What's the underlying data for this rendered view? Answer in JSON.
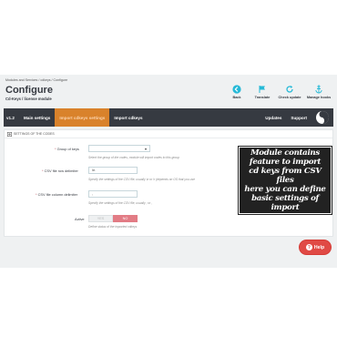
{
  "breadcrumb": [
    "Modules and Services",
    "/",
    "cdkeys",
    "/",
    "Configure"
  ],
  "header": {
    "title": "Configure",
    "subtitle": "Cd-Keys / license module"
  },
  "toolbar": [
    {
      "label": "Back",
      "icon": "back-icon"
    },
    {
      "label": "Translate",
      "icon": "flag-icon"
    },
    {
      "label": "Check update",
      "icon": "refresh-icon"
    },
    {
      "label": "Manage hooks",
      "icon": "anchor-icon"
    }
  ],
  "nav": {
    "version": "v1.2",
    "items": [
      {
        "label": "Main settings",
        "active": false
      },
      {
        "label": "Import cdkeys settings",
        "active": true
      },
      {
        "label": "Import cdkeys",
        "active": false
      }
    ],
    "right_items": [
      "Updates",
      "Support"
    ]
  },
  "panel": {
    "heading": "SETTINGS OF THE CODES",
    "fields": {
      "group_label": "Group of keys",
      "group_help": "Select the group of the codes, module will import codes to this group",
      "row_delim_label": "CSV file row delimiter",
      "row_delim_value": "\\n",
      "row_delim_help": "Specify the settings of the CSV file, usually \\n or \\r (depends on OS that you use",
      "col_delim_label": "CSV file column delimiter",
      "col_delim_value": ",",
      "col_delim_help": "Specify the settings of the CSV file, usually ; or ,",
      "active_label": "Active",
      "active_yes": "YES",
      "active_no": "NO",
      "active_value": "NO",
      "active_help": "Define status of the imported cdkeys"
    }
  },
  "callout": {
    "lines": [
      "Module contains",
      "feature to import",
      "cd keys from CSV files",
      "here you can define",
      "basic settings of import"
    ]
  },
  "help_button": {
    "label": "Help"
  },
  "colors": {
    "nav_bg": "#363a41",
    "nav_active": "#d9822b",
    "toolbar_icon": "#25b9d7",
    "help": "#e04a45",
    "toggle_no": "#e27c85"
  }
}
